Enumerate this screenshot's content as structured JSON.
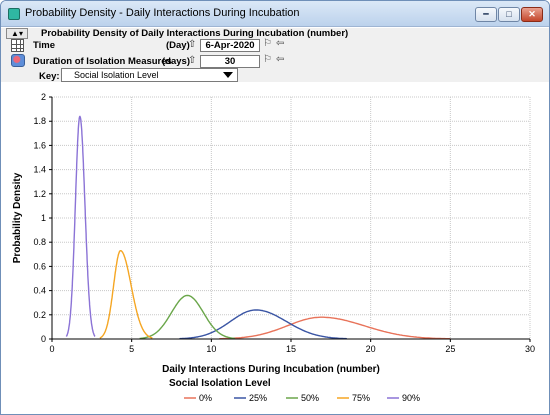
{
  "window": {
    "title": "Probability Density - Daily Interactions During Incubation",
    "minimize_icon": "minimize-icon",
    "maximize_icon": "maximize-icon",
    "close_icon": "close-icon"
  },
  "toolbar": {
    "menu_icon": "view-menu-icon",
    "header": "Probability Density of Daily Interactions During Incubation (number)",
    "time": {
      "label": "Time",
      "unit": "(Day)",
      "value": "6-Apr-2020"
    },
    "duration": {
      "label": "Duration of Isolation Measures",
      "unit": "(days)",
      "value": "30"
    },
    "key": {
      "label": "Key:",
      "value": "Social Isolation Level"
    }
  },
  "chart_data": {
    "type": "line",
    "xlabel": "Daily Interactions During Incubation (number)",
    "ylabel": "Probability Density",
    "xlim": [
      0,
      30
    ],
    "ylim": [
      0,
      2
    ],
    "x_ticks": [
      "0",
      "5",
      "10",
      "15",
      "20",
      "25",
      "30"
    ],
    "y_ticks": [
      "0",
      "0.2",
      "0.4",
      "0.6",
      "0.8",
      "1",
      "1.2",
      "1.4",
      "1.6",
      "1.8",
      "2"
    ],
    "grid": true,
    "legend_title": "Social Isolation Level",
    "legend_placement": "bottom",
    "series": [
      {
        "name": "0%",
        "color": "#e8735a",
        "peak_x": 16.9,
        "peak_y": 0.18,
        "range": [
          10.5,
          25.0
        ]
      },
      {
        "name": "25%",
        "color": "#3a55a4",
        "peak_x": 12.8,
        "peak_y": 0.24,
        "range": [
          8.0,
          18.5
        ]
      },
      {
        "name": "50%",
        "color": "#6aa64a",
        "peak_x": 8.5,
        "peak_y": 0.36,
        "range": [
          5.5,
          11.5
        ]
      },
      {
        "name": "75%",
        "color": "#f5a623",
        "peak_x": 4.3,
        "peak_y": 0.73,
        "range": [
          3.0,
          6.3
        ]
      },
      {
        "name": "90%",
        "color": "#8b73d6",
        "peak_x": 1.75,
        "peak_y": 1.84,
        "range": [
          0.9,
          2.7
        ]
      }
    ]
  }
}
